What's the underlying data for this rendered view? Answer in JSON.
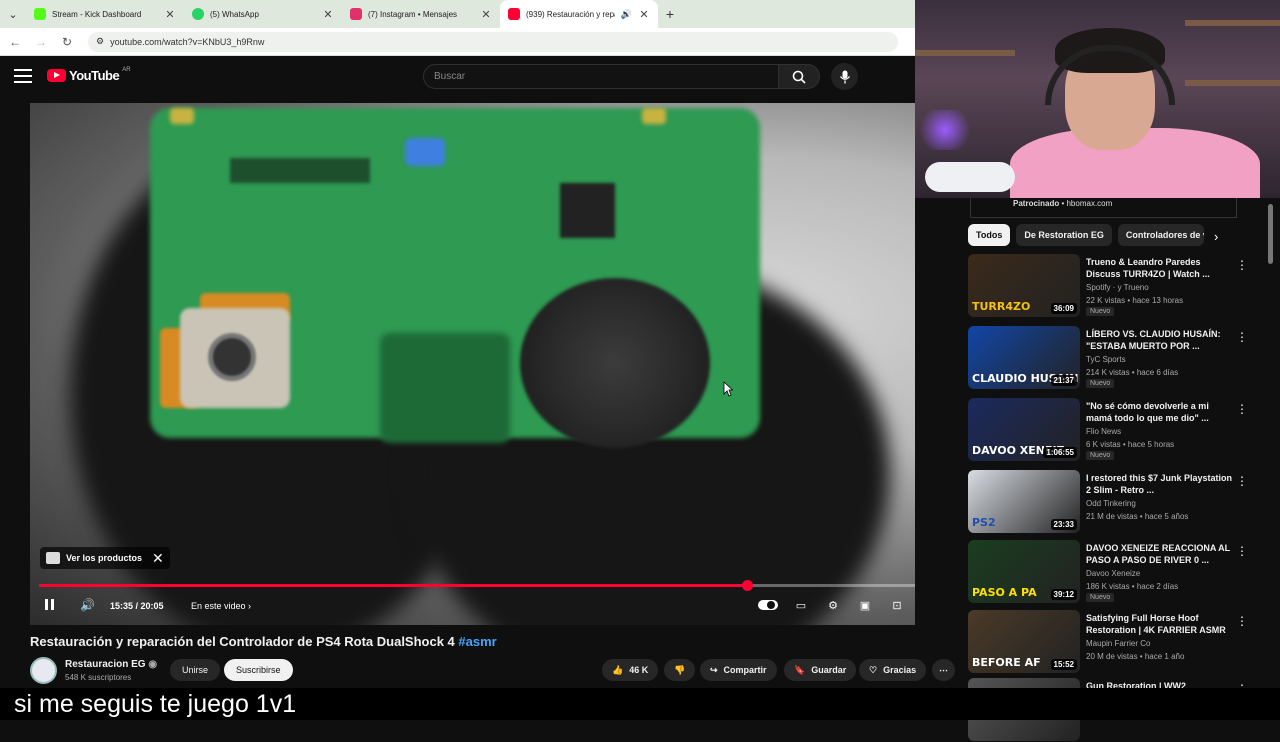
{
  "browser": {
    "tabs": [
      {
        "label": "Stream - Kick Dashboard",
        "color": "#53fc18"
      },
      {
        "label": "(5) WhatsApp",
        "color": "#25d366"
      },
      {
        "label": "(7) Instagram • Mensajes",
        "color": "#e1306c"
      },
      {
        "label": "(939) Restauración y repara",
        "color": "#ff0033"
      }
    ],
    "url": "youtube.com/watch?v=KNbU3_h9Rnw"
  },
  "youtube": {
    "logo": "YouTube",
    "region": "AR",
    "search_placeholder": "Buscar"
  },
  "player": {
    "products_label": "Ver los productos",
    "time": "15:35 / 20:05",
    "chapter": "En este video",
    "progress": 0.776
  },
  "video": {
    "title": "Restauración y reparación del Controlador de PS4 Rota DualShock 4",
    "hashtag": "#asmr",
    "channel": "Restauracion EG",
    "subscribers": "548 K suscriptores",
    "join_label": "Unirse",
    "subscribe_label": "Suscribirse",
    "likes": "46 K",
    "share_label": "Compartir",
    "save_label": "Guardar",
    "thanks_label": "Gracias"
  },
  "sidebar": {
    "sponsor_label": "Patrocinado",
    "sponsor_domain": "hbomax.com",
    "chips": [
      "Todos",
      "De Restoration EG",
      "Controladores de v"
    ],
    "recommendations": [
      {
        "title": "Trueno & Leandro Paredes Discuss TURR4ZO | Watch ...",
        "channel": "Spotify · y Trueno",
        "meta": "22 K vistas • hace 13 horas",
        "badge": "Nuevo",
        "duration": "36:09",
        "thumb_text": "TURR4ZO",
        "bg": "#3b2a1a",
        "accent": "#f4c20d"
      },
      {
        "title": "LÍBERO VS. CLAUDIO HUSAÍN: \"ESTABA MUERTO POR ...",
        "channel": "TyC Sports",
        "meta": "214 K vistas • hace 6 días",
        "badge": "Nuevo",
        "duration": "21:37",
        "thumb_text": "CLAUDIO HUSAIN",
        "bg": "#1246a8",
        "accent": "#ffffff"
      },
      {
        "title": "\"No sé cómo devolverle a mi mamá todo lo que me dio\" ...",
        "channel": "Flio News",
        "meta": "6 K vistas • hace 5 horas",
        "badge": "Nuevo",
        "duration": "1:06:55",
        "thumb_text": "DAVOO XENEIZ",
        "bg": "#1b2a5e",
        "accent": "#ffffff"
      },
      {
        "title": "I restored this $7 Junk Playstation 2 Slim - Retro ...",
        "channel": "Odd Tinkering",
        "meta": "21 M de vistas • hace 5 años",
        "badge": "",
        "duration": "23:33",
        "thumb_text": "PS2",
        "bg": "#d9dde3",
        "accent": "#1f4fb0"
      },
      {
        "title": "DAVOO XENEIZE REACCIONA AL PASO A PASO DE RIVER 0 ...",
        "channel": "Davoo Xeneize",
        "meta": "186 K vistas • hace 2 días",
        "badge": "Nuevo",
        "duration": "39:12",
        "thumb_text": "PASO A PA",
        "bg": "#1a3d1f",
        "accent": "#ffe000"
      },
      {
        "title": "Satisfying Full Horse Hoof Restoration | 4K FARRIER ASMR",
        "channel": "Maupin Farrier Co",
        "meta": "20 M de vistas • hace 1 año",
        "badge": "",
        "duration": "15:52",
        "thumb_text": "BEFORE  AF",
        "bg": "#4a3a28",
        "accent": "#ffffff"
      },
      {
        "title": "Gun Restoration | WW2",
        "channel": "",
        "meta": "",
        "badge": "",
        "duration": "",
        "thumb_text": "",
        "bg": "#555555",
        "accent": "#ffffff"
      }
    ]
  },
  "caption": "si me seguis te juego 1v1"
}
